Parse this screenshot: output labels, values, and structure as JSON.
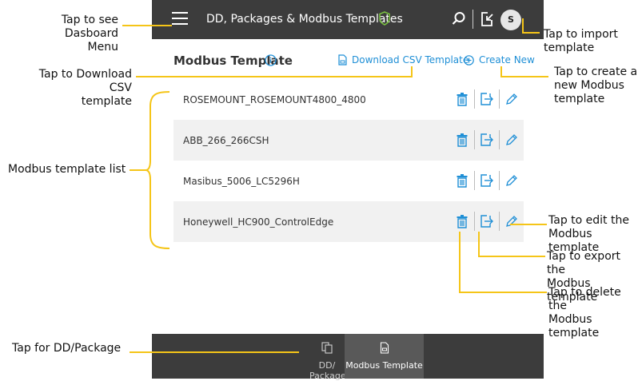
{
  "annotations": {
    "dashboard_menu": "Tap to see Dasboard\nMenu",
    "import_template": "Tap to import\ntemplate",
    "download_csv": "Tap to Download CSV\ntemplate",
    "create_new": "Tap to create a\nnew Modbus\ntemplate",
    "template_list": "Modbus template list",
    "edit_template": "Tap to edit the\nModbus template",
    "export_template": "Tap to export the\nModbus template",
    "delete_template": "Tap to delete the\nModbus template",
    "dd_package": "Tap for DD/Package"
  },
  "appbar": {
    "title": "DD, Packages & Modbus Templates",
    "avatar_initial": "S"
  },
  "page": {
    "title": "Modbus Template",
    "download_csv_label": "Download CSV Template",
    "create_new_label": "Create New"
  },
  "templates": [
    {
      "name": "ROSEMOUNT_ROSEMOUNT4800_4800"
    },
    {
      "name": "ABB_266_266CSH"
    },
    {
      "name": "Masibus_5006_LC5296H"
    },
    {
      "name": "Honeywell_HC900_ControlEdge"
    }
  ],
  "bottom_nav": {
    "tabs": [
      {
        "label": "DD/ Package",
        "icon": "dd-package-icon",
        "active": false
      },
      {
        "label": "Modbus Template",
        "icon": "modbus-template-icon",
        "active": true
      }
    ]
  },
  "colors": {
    "accent": "#1f8fd6",
    "callout_line": "#f5c518",
    "bar_bg": "#3c3c3c",
    "shield": "#7ac142"
  }
}
